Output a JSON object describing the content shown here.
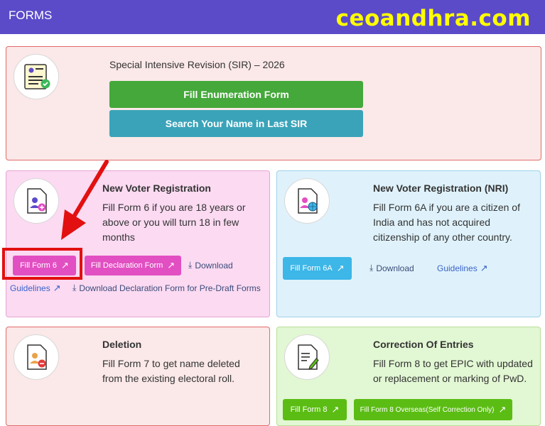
{
  "header": {
    "title": "FORMS",
    "brand": "ceoandhra.com"
  },
  "sir": {
    "heading": "Special Intensive Revision (SIR) – 2026",
    "fill_label": "Fill Enumeration Form",
    "search_label": "Search Your Name in Last SIR"
  },
  "new_voter": {
    "heading": "New Voter Registration",
    "desc_lines": [
      "Fill Form 6 if you are 18 years or",
      "above or you will turn 18 in few",
      "months"
    ],
    "fill_label": "Fill Form 6",
    "declaration_label": "Fill Declaration Form",
    "download_label": "Download",
    "guidelines_label": "Guidelines",
    "predraft_label": "Download Declaration Form for Pre-Draft Forms"
  },
  "nri": {
    "heading": "New Voter Registration (NRI)",
    "desc_lines": [
      "Fill Form 6A if you are a citizen of",
      "India and has not acquired",
      "citizenship of any other country."
    ],
    "fill_label": "Fill Form 6A",
    "download_label": "Download",
    "guidelines_label": "Guidelines"
  },
  "deletion": {
    "heading": "Deletion",
    "desc_lines": [
      "Fill Form 7 to get name deleted",
      "from the existing electoral roll."
    ]
  },
  "correction": {
    "heading": "Correction Of Entries",
    "desc_lines": [
      "Fill Form 8 to get EPIC with updated",
      "or replacement or marking of PwD."
    ],
    "fill_label": "Fill Form 8",
    "overseas_label": "Fill Form 8 Overseas(Self Correction Only)"
  },
  "colors": {
    "header_bg": "#5b4bc9",
    "brand": "#ffff00",
    "green": "#44a83a",
    "teal": "#3aa3b9",
    "pink": "#e24fc2",
    "sky": "#3db6e8",
    "lime": "#5bbd14",
    "highlight": "#e21010"
  }
}
